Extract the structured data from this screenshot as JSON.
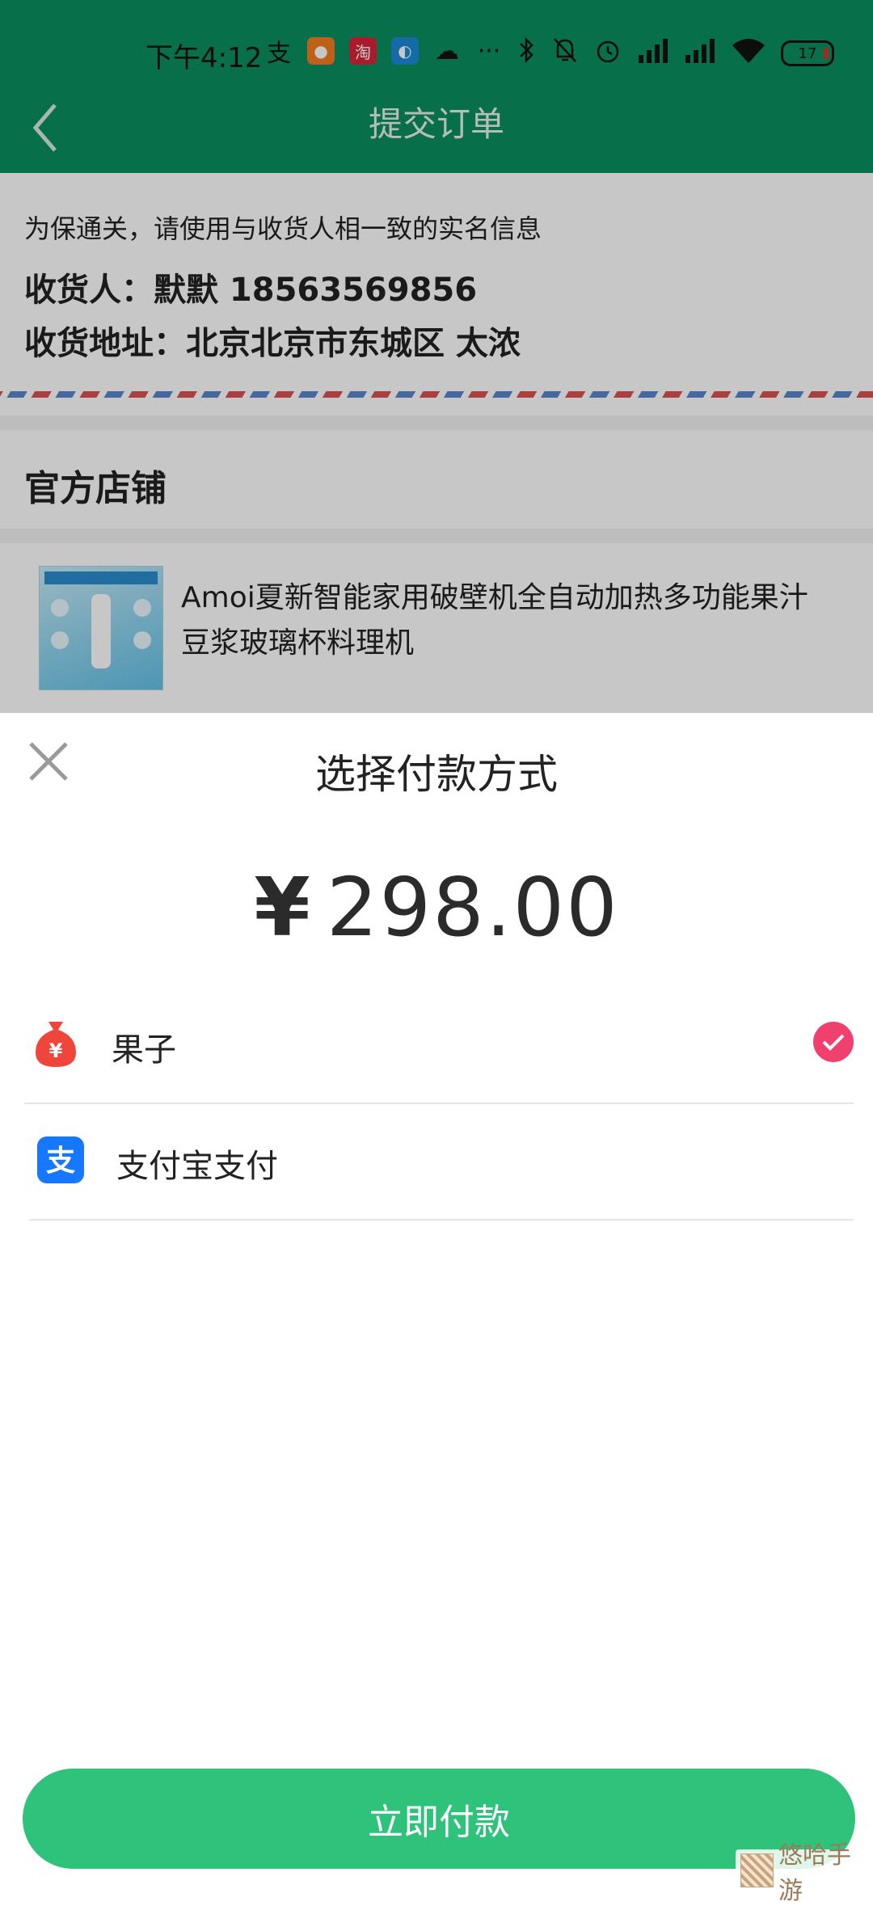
{
  "status_bar": {
    "time": "下午4:12",
    "battery": "17"
  },
  "header": {
    "title": "提交订单"
  },
  "address": {
    "tip": "为保通关，请使用与收货人相一致的实名信息",
    "recipient": "收货人：默默 18563569856",
    "address": "收货地址：北京北京市东城区 太浓"
  },
  "shop": {
    "name": "官方店铺"
  },
  "product": {
    "title": "Amoi夏新智能家用破壁机全自动加热多功能果汁豆浆玻璃杯料理机"
  },
  "payment_sheet": {
    "title": "选择付款方式",
    "currency": "¥",
    "amount": "298.00",
    "options": [
      {
        "label": "果子",
        "icon": "money-bag-icon",
        "selected": true
      },
      {
        "label": "支付宝支付",
        "icon": "alipay-icon",
        "selected": false
      }
    ],
    "pay_button": "立即付款"
  },
  "watermark": {
    "text": "悠哈手游"
  },
  "colors": {
    "header": "#0a8f5e",
    "pay_button": "#2ec27a",
    "check": "#f0406e",
    "alipay": "#1677ff"
  }
}
